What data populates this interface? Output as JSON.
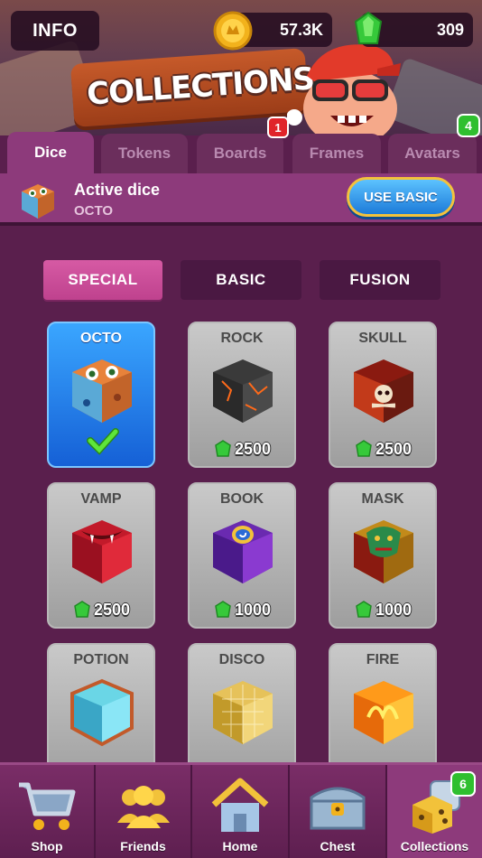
{
  "header": {
    "info_label": "INFO",
    "title": "COLLECTIONS",
    "coins": "57.3K",
    "gems": "309"
  },
  "tabs": [
    {
      "label": "Dice",
      "active": true
    },
    {
      "label": "Tokens"
    },
    {
      "label": "Boards",
      "badge": "1"
    },
    {
      "label": "Frames",
      "badge": "4"
    },
    {
      "label": "Avatars"
    }
  ],
  "active_dice": {
    "title": "Active dice",
    "name": "OCTO",
    "button_label": "USE BASIC"
  },
  "filters": [
    {
      "label": "SPECIAL",
      "active": true
    },
    {
      "label": "BASIC"
    },
    {
      "label": "FUSION"
    }
  ],
  "dice": [
    {
      "name": "OCTO",
      "selected": true
    },
    {
      "name": "ROCK",
      "price": "2500"
    },
    {
      "name": "SKULL",
      "price": "2500"
    },
    {
      "name": "VAMP",
      "price": "2500"
    },
    {
      "name": "BOOK",
      "price": "1000"
    },
    {
      "name": "MASK",
      "price": "1000"
    },
    {
      "name": "POTION"
    },
    {
      "name": "DISCO"
    },
    {
      "name": "FIRE"
    }
  ],
  "nav": [
    {
      "label": "Shop"
    },
    {
      "label": "Friends"
    },
    {
      "label": "Home"
    },
    {
      "label": "Chest"
    },
    {
      "label": "Collections",
      "badge": "6",
      "active": true
    }
  ],
  "colors": {
    "background": "#5a1f4d",
    "tab_active": "#8d3a7b",
    "filter_active": "#c94a98",
    "card_selected": "#1f7ce6",
    "gem": "#36c93a",
    "coin": "#f2b21c"
  }
}
